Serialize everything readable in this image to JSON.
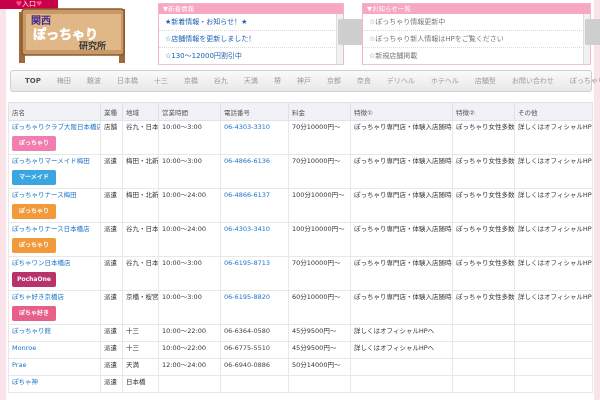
{
  "enter": {
    "label": "入口"
  },
  "logo": {
    "line1": "関西",
    "line2": "ぽっちゃり",
    "line3": "研究所"
  },
  "news_left": {
    "header": "▼新着情報",
    "items": [
      "★新着情報・お知らせ！★",
      "☆店舗情報を更新しました！",
      "☆130～12000円割引中"
    ]
  },
  "news_right": {
    "header": "▼お知らせ一覧",
    "items": [
      "☆ぽっちゃり情報更新中",
      "☆ぽっちゃり新人情報はHPをご覧ください",
      "☆新規店舗掲載"
    ]
  },
  "nav": {
    "items": [
      "TOP",
      "梅田",
      "難波",
      "日本橋",
      "十三",
      "京橋",
      "谷九",
      "天満",
      "堺",
      "神戸",
      "京都",
      "奈良",
      "デリヘル",
      "ホテヘル",
      "店舗型",
      "お問い合わせ",
      "ぽっちゃり研究所"
    ]
  },
  "table": {
    "headers": [
      "店名",
      "業種",
      "地域",
      "営業時間",
      "電話番号",
      "料金",
      "特徴①",
      "特徴②",
      "その他"
    ],
    "rows": [
      {
        "name": "ぽっちゃりクラブ大阪日本橋店",
        "type": "店舗",
        "area": "谷九・日本橋",
        "hours": "10:00～3:00",
        "tel": "06-4303-3310",
        "price": "70分10000円～",
        "f1": "ぽっちゃり専門店・体験入店随時募集",
        "f2": "ぽっちゃり女性多数在籍中",
        "other": "詳しくはオフィシャルHPへ",
        "thumb": "ぽっちゃり",
        "color": "#f27db0",
        "telLink": true
      },
      {
        "name": "ぽっちゃりマーメイド梅田",
        "type": "派遣",
        "area": "梅田・北新地",
        "hours": "10:00～3:00",
        "tel": "06-4866-6136",
        "price": "70分10000円～",
        "f1": "ぽっちゃり専門店・体験入店随時募集",
        "f2": "ぽっちゃり女性多数在籍中",
        "other": "詳しくはオフィシャルHPへ",
        "thumb": "マーメイド",
        "color": "#3aa5e0",
        "telLink": true
      },
      {
        "name": "ぽっちゃりナース梅田",
        "type": "派遣",
        "area": "梅田・北新地",
        "hours": "10:00～24:00",
        "tel": "06-4866-6137",
        "price": "100分10000円～",
        "f1": "ぽっちゃり専門店・体験入店随時募集",
        "f2": "ぽっちゃり女性多数在籍中",
        "other": "詳しくはオフィシャルHPへ",
        "thumb": "ぽっちゃり",
        "color": "#f29a3a",
        "telLink": true
      },
      {
        "name": "ぽっちゃりナース日本橋店",
        "type": "派遣",
        "area": "谷九・日本橋",
        "hours": "10:00～24:00",
        "tel": "06-4303-3410",
        "price": "100分10000円～",
        "f1": "ぽっちゃり専門店・体験入店随時募集",
        "f2": "ぽっちゃり女性多数在籍中",
        "other": "詳しくはオフィシャルHPへ",
        "thumb": "ぽっちゃり",
        "color": "#f29a3a",
        "telLink": true
      },
      {
        "name": "ぽちゃワン日本橋店",
        "type": "派遣",
        "area": "谷九・日本橋",
        "hours": "10:00～3:00",
        "tel": "06-6195-8713",
        "price": "70分10000円～",
        "f1": "ぽっちゃり専門店・体験入店随時募集",
        "f2": "ぽっちゃり女性多数在籍中",
        "other": "詳しくはオフィシャルHPへ",
        "thumb": "PochaOne",
        "color": "#b8336a",
        "telLink": true
      },
      {
        "name": "ぽちゃ好き京橋店",
        "type": "派遣",
        "area": "京橋・桜宮",
        "hours": "10:00～3:00",
        "tel": "06-6195-8820",
        "price": "60分10000円～",
        "f1": "ぽっちゃり専門店・体験入店随時募集中",
        "f2": "ぽっちゃり女性多数在籍中",
        "other": "詳しくはオフィシャルHPへ!",
        "thumb": "ぽちゃ好き",
        "color": "#e8608a",
        "telLink": true
      },
      {
        "name": "ぽっちゃり館",
        "type": "派遣",
        "area": "十三",
        "hours": "10:00～22:00",
        "tel": "06-6364-0580",
        "price": "45分9500円～",
        "f1": "詳しくはオフィシャルHPへ",
        "f2": "",
        "other": "",
        "thumb": "",
        "color": "",
        "telLink": false
      },
      {
        "name": "Monroe",
        "type": "派遣",
        "area": "十三",
        "hours": "10:00～22:00",
        "tel": "06-6775-5510",
        "price": "45分9500円～",
        "f1": "詳しくはオフィシャルHPへ",
        "f2": "",
        "other": "",
        "thumb": "",
        "color": "",
        "telLink": false
      },
      {
        "name": "Prae",
        "type": "派遣",
        "area": "天満",
        "hours": "12:00～24:00",
        "tel": "06-6940-0886",
        "price": "50分14000円～",
        "f1": "",
        "f2": "",
        "other": "",
        "thumb": "",
        "color": "",
        "telLink": false
      },
      {
        "name": "ぽちゃ神",
        "type": "派遣",
        "area": "日本橋",
        "hours": "",
        "tel": "",
        "price": "",
        "f1": "",
        "f2": "",
        "other": "",
        "thumb": "",
        "color": "",
        "telLink": false
      }
    ]
  }
}
